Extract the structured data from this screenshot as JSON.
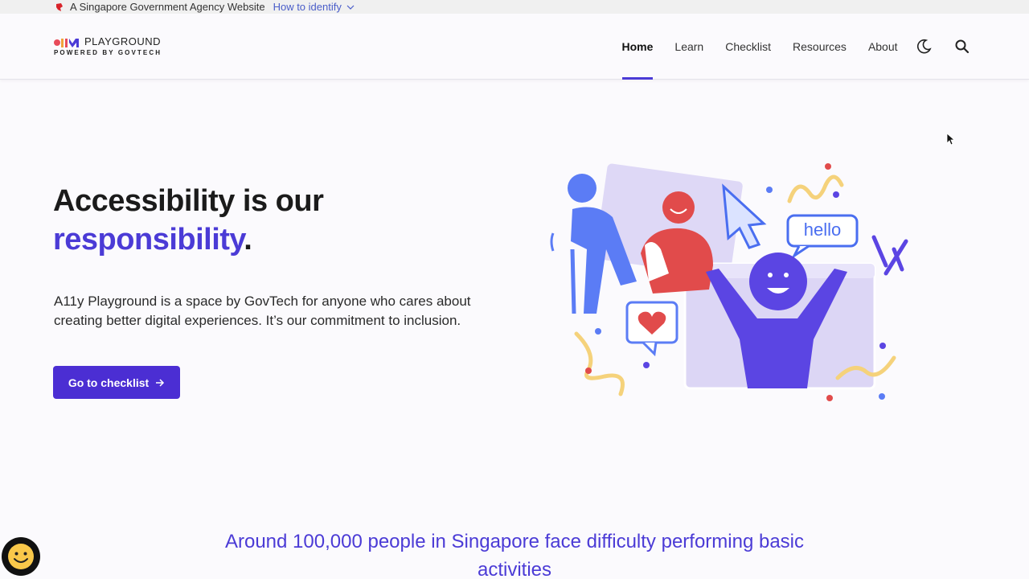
{
  "masthead": {
    "text": "A Singapore Government Agency Website",
    "identify_label": "How to identify"
  },
  "header": {
    "logo_title": "PLAYGROUND",
    "logo_subtitle": "POWERED BY GOVTECH",
    "nav": [
      {
        "label": "Home",
        "active": true
      },
      {
        "label": "Learn"
      },
      {
        "label": "Checklist"
      },
      {
        "label": "Resources"
      },
      {
        "label": "About"
      }
    ],
    "icons": [
      "moon-icon",
      "search-icon"
    ]
  },
  "hero": {
    "title_line1": "Accessibility is our",
    "title_accent": "responsibility",
    "title_period": ".",
    "description": "A11y Playground is a space by GovTech for anyone who cares about creating better digital experiences. It’s our commitment to inclusion.",
    "cta_label": "Go to checklist",
    "illustration": {
      "speech_bubble_text": "hello"
    }
  },
  "stat_text": "Around 100,000 people in Singapore face difficulty performing basic activities",
  "colors": {
    "accent": "#4b3bd6",
    "button": "#4b2ed3",
    "link": "#4a5dc9"
  }
}
